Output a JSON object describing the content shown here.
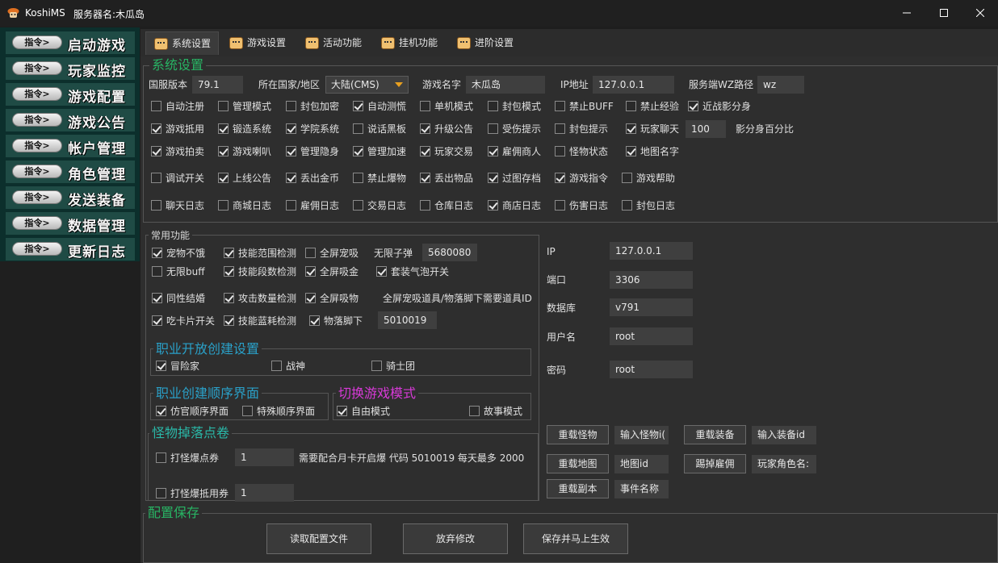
{
  "window": {
    "app_name": "KoshiMS",
    "server_label": "服务器名:木瓜岛",
    "minimize": "—",
    "maximize": "☐",
    "close": "✕"
  },
  "sidebar": {
    "items": [
      {
        "pill": "指令>",
        "label": "启动游戏"
      },
      {
        "pill": "指令>",
        "label": "玩家监控"
      },
      {
        "pill": "指令>",
        "label": "游戏配置"
      },
      {
        "pill": "指令>",
        "label": "游戏公告"
      },
      {
        "pill": "指令>",
        "label": "帐户管理"
      },
      {
        "pill": "指令>",
        "label": "角色管理"
      },
      {
        "pill": "指令>",
        "label": "发送装备"
      },
      {
        "pill": "指令>",
        "label": "数据管理"
      },
      {
        "pill": "指令>",
        "label": "更新日志"
      }
    ]
  },
  "tabs": [
    {
      "label": "系统设置",
      "active": true
    },
    {
      "label": "游戏设置",
      "active": false
    },
    {
      "label": "活动功能",
      "active": false
    },
    {
      "label": "挂机功能",
      "active": false
    },
    {
      "label": "进阶设置",
      "active": false
    }
  ],
  "system": {
    "title": "系统设置",
    "version_label": "国服版本",
    "version_value": "79.1",
    "country_label": "所在国家/地区",
    "country_value": "大陆(CMS)",
    "game_name_label": "游戏名字",
    "game_name_value": "木瓜岛",
    "ip_label": "IP地址",
    "ip_value": "127.0.0.1",
    "wz_label": "服务端WZ路径",
    "wz_value": "wz",
    "chat_count_value": "100",
    "clone_percent_label": "影分身百分比",
    "checkbox_rows": [
      [
        {
          "label": "自动注册",
          "checked": false
        },
        {
          "label": "管理模式",
          "checked": false
        },
        {
          "label": "封包加密",
          "checked": false
        },
        {
          "label": "自动测慌",
          "checked": true
        },
        {
          "label": "单机模式",
          "checked": false
        },
        {
          "label": "封包模式",
          "checked": false
        },
        {
          "label": "禁止BUFF",
          "checked": false
        },
        {
          "label": "禁止经验",
          "checked": false
        },
        {
          "label": "近战影分身",
          "checked": true
        }
      ],
      [
        {
          "label": "游戏抵用",
          "checked": true
        },
        {
          "label": "锻造系统",
          "checked": true
        },
        {
          "label": "学院系统",
          "checked": true
        },
        {
          "label": "说话黑板",
          "checked": false
        },
        {
          "label": "升级公告",
          "checked": true
        },
        {
          "label": "受伤提示",
          "checked": false
        },
        {
          "label": "封包提示",
          "checked": false
        },
        {
          "label": "玩家聊天",
          "checked": true
        }
      ],
      [
        {
          "label": "游戏拍卖",
          "checked": true
        },
        {
          "label": "游戏喇叭",
          "checked": true
        },
        {
          "label": "管理隐身",
          "checked": true
        },
        {
          "label": "管理加速",
          "checked": true
        },
        {
          "label": "玩家交易",
          "checked": true
        },
        {
          "label": "雇佣商人",
          "checked": true
        },
        {
          "label": "怪物状态",
          "checked": false
        },
        {
          "label": "地图名字",
          "checked": true
        }
      ],
      [
        {
          "label": "调试开关",
          "checked": false
        },
        {
          "label": "上线公告",
          "checked": true
        },
        {
          "label": "丢出金币",
          "checked": true
        },
        {
          "label": "禁止爆物",
          "checked": false
        },
        {
          "label": "丢出物品",
          "checked": true
        },
        {
          "label": "过图存档",
          "checked": true
        },
        {
          "label": "游戏指令",
          "checked": true
        },
        {
          "label": "游戏帮助",
          "checked": false
        }
      ],
      [
        {
          "label": "聊天日志",
          "checked": false
        },
        {
          "label": "商城日志",
          "checked": false
        },
        {
          "label": "雇佣日志",
          "checked": false
        },
        {
          "label": "交易日志",
          "checked": false
        },
        {
          "label": "仓库日志",
          "checked": false
        },
        {
          "label": "商店日志",
          "checked": true
        },
        {
          "label": "伤害日志",
          "checked": false
        },
        {
          "label": "封包日志",
          "checked": false
        }
      ]
    ]
  },
  "common": {
    "title": "常用功能",
    "unlimited_bullet_label": "无限子弹",
    "unlimited_bullet_value": "5680080",
    "fullscreen_note": "全屏宠吸道具/物落脚下需要道具ID",
    "item_id_value": "5010019",
    "rows": [
      [
        {
          "label": "宠物不饿",
          "checked": true
        },
        {
          "label": "技能范围检测",
          "checked": true
        },
        {
          "label": "全屏宠吸",
          "checked": false
        }
      ],
      [
        {
          "label": "无限buff",
          "checked": false
        },
        {
          "label": "技能段数检测",
          "checked": true
        },
        {
          "label": "全屏吸金",
          "checked": true
        },
        {
          "label": "套装气泡开关",
          "checked": true
        }
      ],
      [
        {
          "label": "同性结婚",
          "checked": true
        },
        {
          "label": "攻击数量检测",
          "checked": true
        },
        {
          "label": "全屏吸物",
          "checked": true
        }
      ],
      [
        {
          "label": "吃卡片开关",
          "checked": true
        },
        {
          "label": "技能蓝耗检测",
          "checked": true
        },
        {
          "label": "物落脚下",
          "checked": true
        }
      ]
    ]
  },
  "job_open": {
    "title": "职业开放创建设置",
    "items": [
      {
        "label": "冒险家",
        "checked": true
      },
      {
        "label": "战神",
        "checked": false
      },
      {
        "label": "骑士团",
        "checked": false
      }
    ]
  },
  "job_order": {
    "title": "职业创建顺序界面",
    "items": [
      {
        "label": "仿官顺序界面",
        "checked": true
      },
      {
        "label": "特殊顺序界面",
        "checked": false
      }
    ]
  },
  "game_mode": {
    "title": "切换游戏模式",
    "items": [
      {
        "label": "自由模式",
        "checked": true
      },
      {
        "label": "故事模式",
        "checked": false
      }
    ]
  },
  "drop": {
    "title": "怪物掉落点卷",
    "points_label": "打怪爆点券",
    "points_value": "1",
    "note": "需要配合月卡开启爆 代码 5010019 每天最多 2000",
    "voucher_label": "打怪爆抵用券",
    "voucher_value": "1"
  },
  "db": {
    "ip_label": "IP",
    "ip_value": "127.0.0.1",
    "port_label": "端口",
    "port_value": "3306",
    "db_label": "数据库",
    "db_value": "v791",
    "user_label": "用户名",
    "user_value": "root",
    "pass_label": "密码",
    "pass_value": "root"
  },
  "reload": {
    "reload_monster": "重载怪物",
    "monster_input": "输入怪物i(",
    "reload_equip": "重载装备",
    "equip_input": "输入装备id",
    "reload_map": "重载地图",
    "map_input": "地图id",
    "kick_hire": "踢掉雇佣",
    "player_name_input": "玩家角色名:",
    "reload_instance": "重载副本",
    "event_input": "事件名称"
  },
  "save": {
    "title": "配置保存",
    "read_button": "读取配置文件",
    "discard_button": "放弃修改",
    "save_button": "保存并马上生效"
  }
}
